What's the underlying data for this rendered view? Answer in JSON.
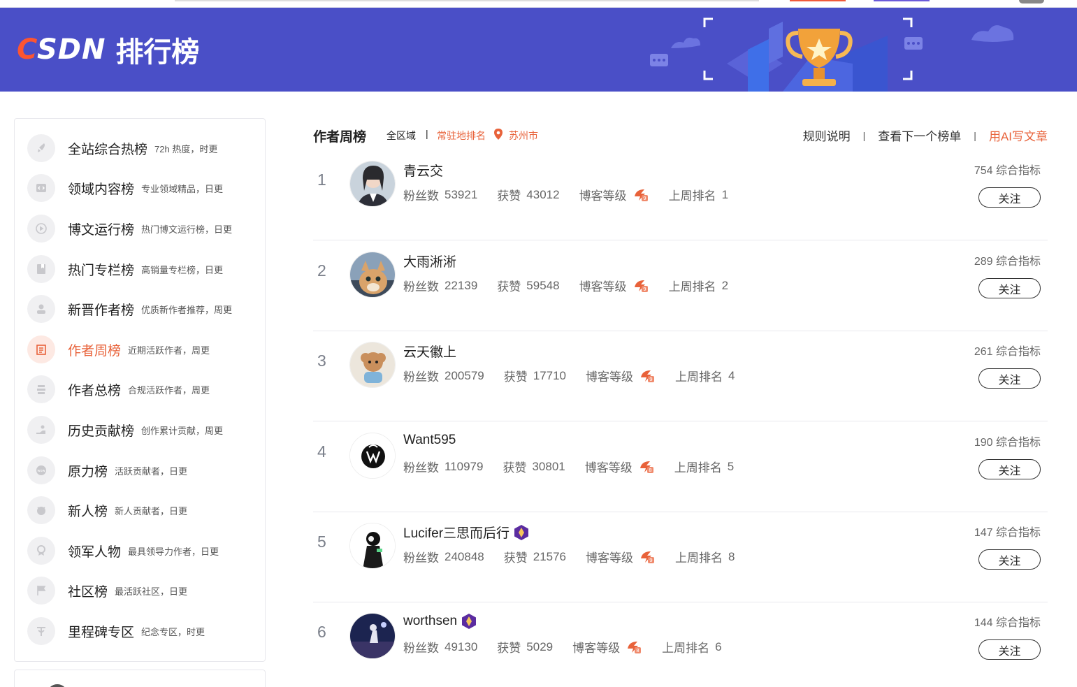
{
  "header": {
    "logo_text": "CSDN",
    "title": "排行榜"
  },
  "sidebar": {
    "items": [
      {
        "name": "全站综合热榜",
        "desc": "72h 热度，时更",
        "icon": "rocket-icon",
        "active": false
      },
      {
        "name": "领域内容榜",
        "desc": "专业领域精品，日更",
        "icon": "code-icon",
        "active": false
      },
      {
        "name": "博文运行榜",
        "desc": "热门博文运行榜，日更",
        "icon": "play-icon",
        "active": false
      },
      {
        "name": "热门专栏榜",
        "desc": "高销量专栏榜，日更",
        "icon": "book-icon",
        "active": false
      },
      {
        "name": "新晋作者榜",
        "desc": "优质新作者推荐，周更",
        "icon": "user-icon",
        "active": false
      },
      {
        "name": "作者周榜",
        "desc": "近期活跃作者，周更",
        "icon": "calendar-icon",
        "active": true
      },
      {
        "name": "作者总榜",
        "desc": "合规活跃作者，周更",
        "icon": "group-icon",
        "active": false
      },
      {
        "name": "历史贡献榜",
        "desc": "创作累计贡献，周更",
        "icon": "hand-icon",
        "active": false
      },
      {
        "name": "原力榜",
        "desc": "活跃贡献者，日更",
        "icon": "wow-icon",
        "active": false
      },
      {
        "name": "新人榜",
        "desc": "新人贡献者，日更",
        "icon": "newbie-icon",
        "active": false
      },
      {
        "name": "领军人物",
        "desc": "最具领导力作者，日更",
        "icon": "medal-icon",
        "active": false
      },
      {
        "name": "社区榜",
        "desc": "最活跃社区，日更",
        "icon": "flag-icon",
        "active": false
      },
      {
        "name": "里程碑专区",
        "desc": "纪念专区，时更",
        "icon": "milestone-icon",
        "active": false
      }
    ]
  },
  "main": {
    "heading": "作者周榜",
    "region": "全区域",
    "separator": "|",
    "resident_label": "常驻地排名",
    "city": "苏州市",
    "links": {
      "rules": "规则说明",
      "next_board": "查看下一个榜单",
      "ai_write": "用AI写文章",
      "sep": "|"
    },
    "stat_labels": {
      "fans": "粉丝数",
      "likes": "获赞",
      "level": "博客等级",
      "last_week": "上周排名"
    },
    "follow_label": "关注",
    "score_suffix": "综合指标",
    "rows": [
      {
        "rank": "1",
        "name": "青云交",
        "fans": "53921",
        "likes": "43012",
        "last_week": "1",
        "score": "754",
        "badge": false
      },
      {
        "rank": "2",
        "name": "大雨淅淅",
        "fans": "22139",
        "likes": "59548",
        "last_week": "2",
        "score": "289",
        "badge": false
      },
      {
        "rank": "3",
        "name": "云天徽上",
        "fans": "200579",
        "likes": "17710",
        "last_week": "4",
        "score": "261",
        "badge": false
      },
      {
        "rank": "4",
        "name": "Want595",
        "fans": "110979",
        "likes": "30801",
        "last_week": "5",
        "score": "190",
        "badge": false
      },
      {
        "rank": "5",
        "name": "Lucifer三思而后行",
        "fans": "240848",
        "likes": "21576",
        "last_week": "8",
        "score": "147",
        "badge": true
      },
      {
        "rank": "6",
        "name": "worthsen",
        "fans": "49130",
        "likes": "5029",
        "last_week": "6",
        "score": "144",
        "badge": true
      }
    ]
  },
  "colors": {
    "banner": "#4a4fc7",
    "accent": "#e8623a",
    "brand_c": "#fc5531"
  }
}
